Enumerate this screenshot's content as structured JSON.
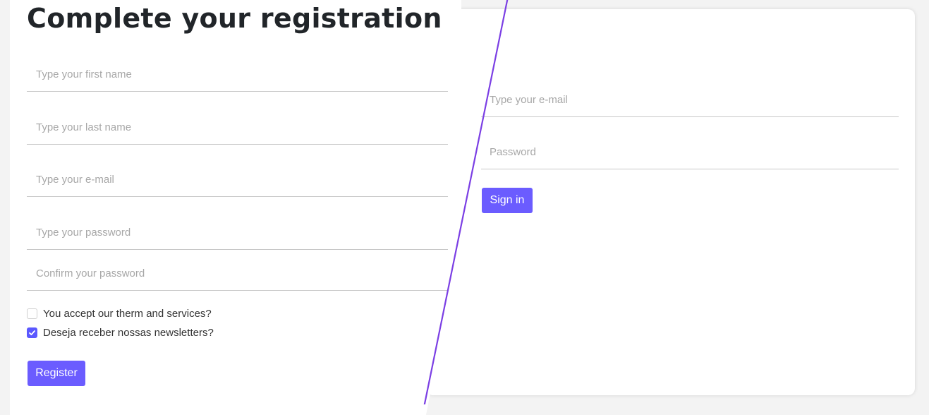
{
  "register": {
    "title": "Complete your registration",
    "fields": [
      {
        "placeholder": "Type your first name"
      },
      {
        "placeholder": "Type your last name"
      },
      {
        "placeholder": "Type your e-mail"
      },
      {
        "placeholder": "Type your password"
      },
      {
        "placeholder": "Confirm your password"
      }
    ],
    "checkboxes": [
      {
        "label": "You accept our therm and services?",
        "checked": false
      },
      {
        "label": "Deseja receber nossas newsletters?",
        "checked": true
      }
    ],
    "button_label": "Register"
  },
  "login": {
    "email_placeholder": "Type your e-mail",
    "password_placeholder": "Password",
    "button_label": "Sign in"
  },
  "colors": {
    "accent": "#6b5cff",
    "divider": "#7b3fe4",
    "checked": "#5b58ff"
  }
}
